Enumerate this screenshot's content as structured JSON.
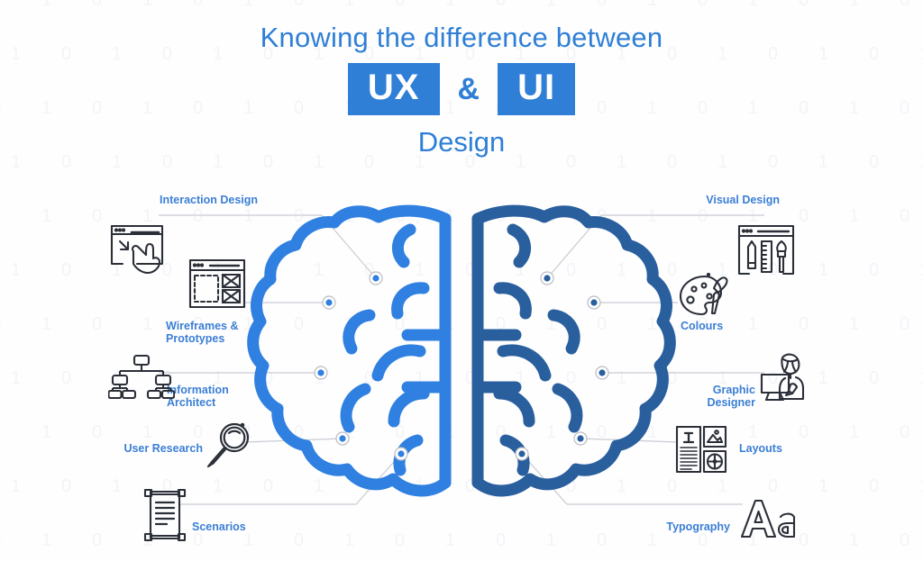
{
  "header": {
    "line1": "Knowing the difference between",
    "badge_ux": "UX",
    "amp": "&",
    "badge_ui": "UI",
    "line2": "Design"
  },
  "colors": {
    "title_blue": "#2f7fd6",
    "badge_bg": "#2f7fd6",
    "label_blue": "#3b7fd4",
    "brain_left": "#2f80e0",
    "brain_right": "#2a5f9e",
    "connector_gray": "#c9ccd2",
    "icon_dark": "#2b2f38",
    "background": "#ffffff",
    "pattern": "#f3f4f7"
  },
  "left_side": {
    "side_name": "UX",
    "items": [
      {
        "label": "Interaction Design",
        "icon": "cursor-window-icon"
      },
      {
        "label": "Wireframes &\nPrototypes",
        "icon": "wireframe-icon"
      },
      {
        "label": "Information\nArchitect",
        "icon": "sitemap-icon"
      },
      {
        "label": "User Research",
        "icon": "magnifier-icon"
      },
      {
        "label": "Scenarios",
        "icon": "scroll-icon"
      }
    ]
  },
  "right_side": {
    "side_name": "UI",
    "items": [
      {
        "label": "Visual Design",
        "icon": "design-tools-icon"
      },
      {
        "label": "Colours",
        "icon": "palette-icon"
      },
      {
        "label": "Graphic\nDesigner",
        "icon": "designer-person-icon"
      },
      {
        "label": "Layouts",
        "icon": "layout-grid-icon"
      },
      {
        "label": "Typography",
        "icon": "typography-aa-icon"
      }
    ]
  },
  "brain": {
    "alt": "two-hemisphere brain illustration",
    "left_hemisphere_label": "left-hemisphere",
    "right_hemisphere_label": "right-hemisphere",
    "node_count_left": 5,
    "node_count_right": 5
  },
  "background_pattern": {
    "glyphs": [
      "0",
      "1"
    ],
    "description": "faint repeating binary digits"
  }
}
